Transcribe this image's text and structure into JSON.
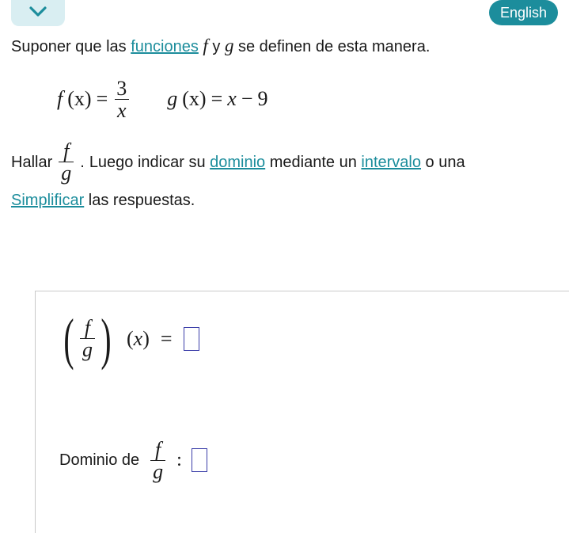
{
  "lang_label": "English",
  "prompt": {
    "pre": "Suponer que las ",
    "funciones_link": "funciones",
    "between1": " ",
    "fvar": "f",
    "y": " y ",
    "gvar": "g",
    "post": " se definen de esta manera."
  },
  "defs": {
    "f_label": "f",
    "g_label": "g",
    "x_open": "(",
    "x_var": "x",
    "x_close": ")",
    "eq": "=",
    "f_num": "3",
    "f_den": "x",
    "g_rhs_a": "x",
    "g_rhs_op": "−",
    "g_rhs_b": "9"
  },
  "hallar": {
    "pre": "Hallar ",
    "frac_top": "f",
    "frac_bot": "g",
    "dot": ".",
    "mid1": " Luego indicar su ",
    "dominio_link": "dominio",
    "mid2": " mediante un ",
    "intervalo_link": "intervalo",
    "mid3": " o una "
  },
  "simpl": {
    "link": "Simplificar",
    "post": " las respuestas."
  },
  "answer": {
    "lp": "(",
    "rp": ")",
    "frac_top": "f",
    "frac_bot": "g",
    "xof_open": "(",
    "xof_var": "x",
    "xof_close": ")",
    "eq": "=",
    "domain_label": "Dominio de ",
    "colon": ":"
  }
}
